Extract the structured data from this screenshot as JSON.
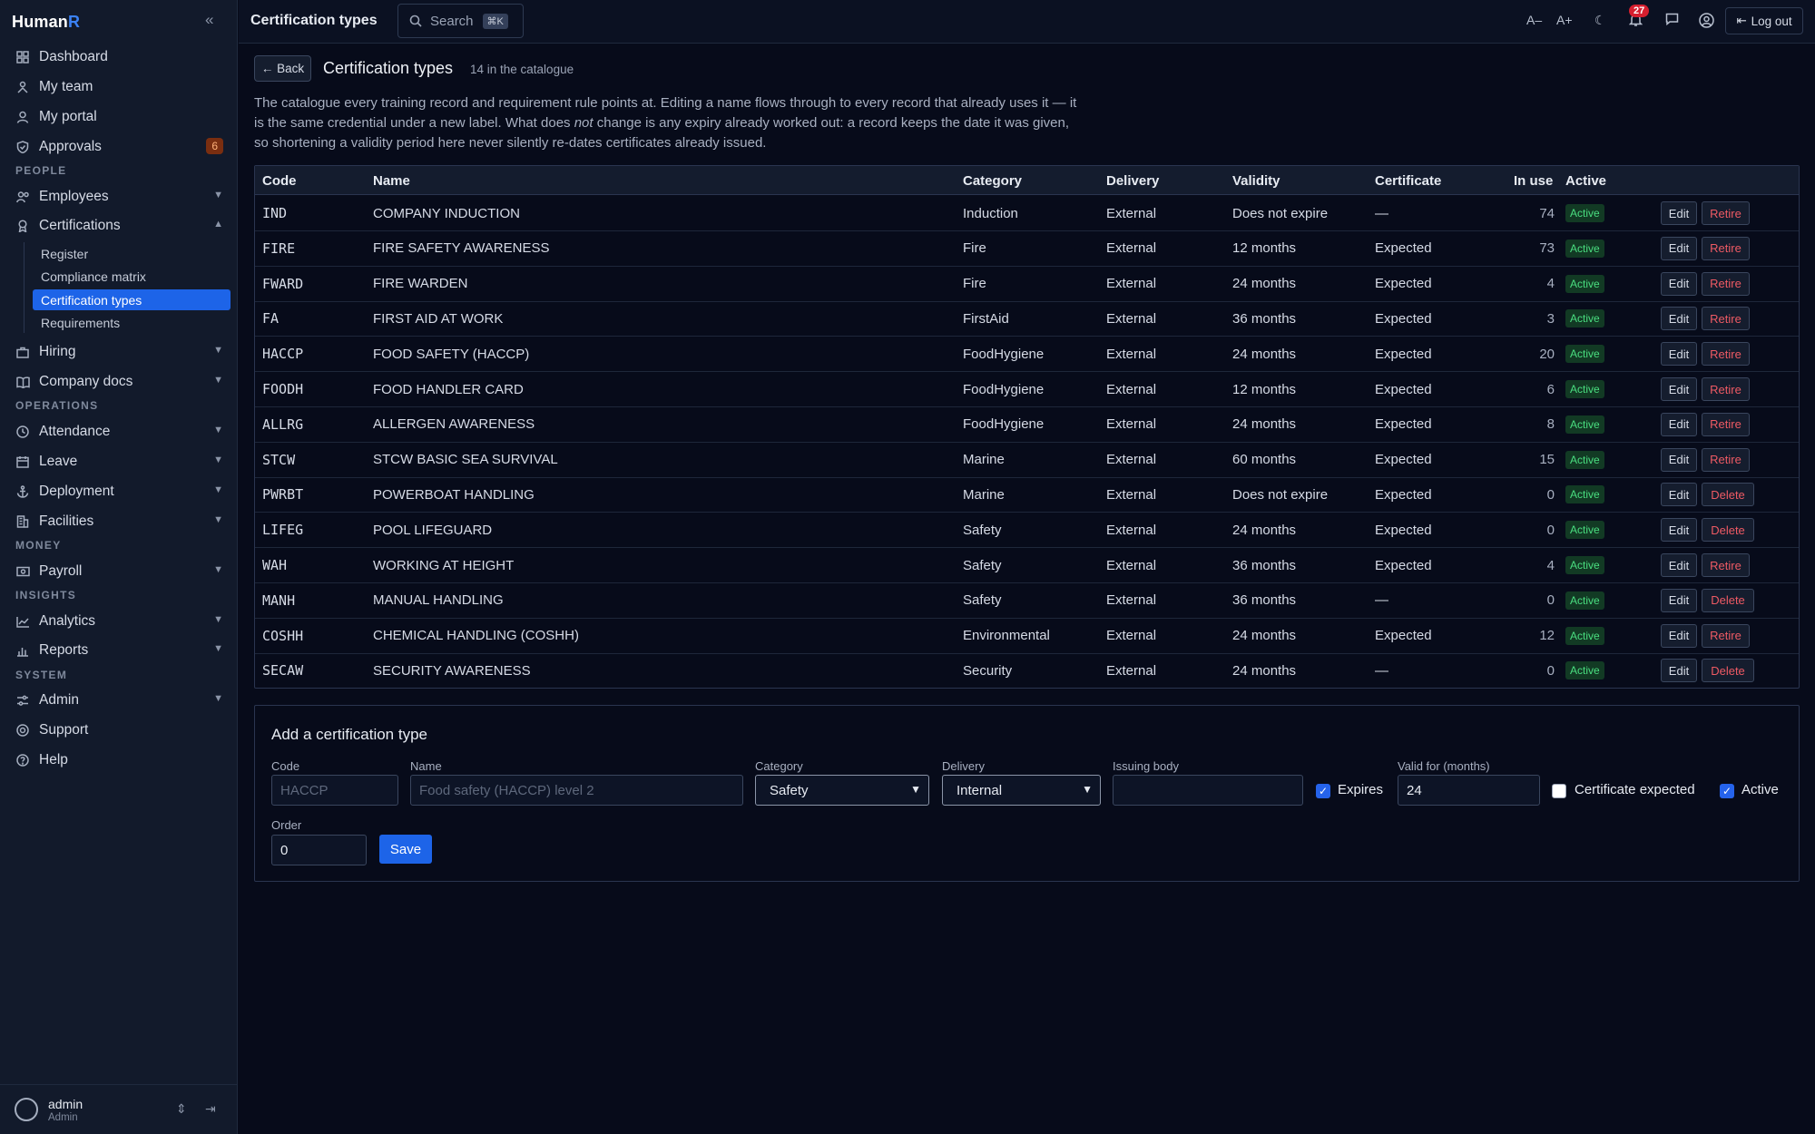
{
  "app": {
    "name_prefix": "Human",
    "name_accent": "R"
  },
  "sidebar": {
    "items": [
      {
        "label": "Dashboard"
      },
      {
        "label": "My team"
      },
      {
        "label": "My portal"
      },
      {
        "label": "Approvals",
        "badge": "6"
      },
      {
        "label": "Employees"
      },
      {
        "label": "Certifications"
      },
      {
        "label": "Hiring"
      },
      {
        "label": "Company docs"
      },
      {
        "label": "Attendance"
      },
      {
        "label": "Leave"
      },
      {
        "label": "Deployment"
      },
      {
        "label": "Facilities"
      },
      {
        "label": "Payroll"
      },
      {
        "label": "Analytics"
      },
      {
        "label": "Reports"
      },
      {
        "label": "Admin"
      },
      {
        "label": "Support"
      },
      {
        "label": "Help"
      }
    ],
    "sections": [
      "PEOPLE",
      "OPERATIONS",
      "MONEY",
      "INSIGHTS",
      "SYSTEM"
    ],
    "sub_items": [
      "Register",
      "Compliance matrix",
      "Certification types",
      "Requirements"
    ],
    "user": {
      "name": "admin",
      "role": "Admin"
    }
  },
  "topbar": {
    "title": "Certification types",
    "search_label": "Search",
    "search_shortcut": "⌘K",
    "font_smaller": "A–",
    "font_larger": "A+",
    "notification_count": "27",
    "logout_label": "Log out"
  },
  "page": {
    "back_label": "← Back",
    "title": "Certification types",
    "count_text": "14 in the catalogue",
    "intro_part1": "The catalogue every training record and requirement rule points at. Editing a name flows through to every record that already uses it — it is the same credential under a new label. What does ",
    "intro_em": "not",
    "intro_part2": " change is any expiry already worked out: a record keeps the date it was given, so shortening a validity period here never silently re-dates certificates already issued."
  },
  "table": {
    "columns": [
      "Code",
      "Name",
      "Category",
      "Delivery",
      "Validity",
      "Certificate",
      "In use",
      "Active"
    ],
    "edit_label": "Edit",
    "rows": [
      {
        "code": "IND",
        "name": "COMPANY INDUCTION",
        "category": "Induction",
        "delivery": "External",
        "validity": "Does not expire",
        "certificate": "—",
        "in_use": "74",
        "active": "Active",
        "action": "Retire"
      },
      {
        "code": "FIRE",
        "name": "FIRE SAFETY AWARENESS",
        "category": "Fire",
        "delivery": "External",
        "validity": "12 months",
        "certificate": "Expected",
        "in_use": "73",
        "active": "Active",
        "action": "Retire"
      },
      {
        "code": "FWARD",
        "name": "FIRE WARDEN",
        "category": "Fire",
        "delivery": "External",
        "validity": "24 months",
        "certificate": "Expected",
        "in_use": "4",
        "active": "Active",
        "action": "Retire"
      },
      {
        "code": "FA",
        "name": "FIRST AID AT WORK",
        "category": "FirstAid",
        "delivery": "External",
        "validity": "36 months",
        "certificate": "Expected",
        "in_use": "3",
        "active": "Active",
        "action": "Retire"
      },
      {
        "code": "HACCP",
        "name": "FOOD SAFETY (HACCP)",
        "category": "FoodHygiene",
        "delivery": "External",
        "validity": "24 months",
        "certificate": "Expected",
        "in_use": "20",
        "active": "Active",
        "action": "Retire"
      },
      {
        "code": "FOODH",
        "name": "FOOD HANDLER CARD",
        "category": "FoodHygiene",
        "delivery": "External",
        "validity": "12 months",
        "certificate": "Expected",
        "in_use": "6",
        "active": "Active",
        "action": "Retire"
      },
      {
        "code": "ALLRG",
        "name": "ALLERGEN AWARENESS",
        "category": "FoodHygiene",
        "delivery": "External",
        "validity": "24 months",
        "certificate": "Expected",
        "in_use": "8",
        "active": "Active",
        "action": "Retire"
      },
      {
        "code": "STCW",
        "name": "STCW BASIC SEA SURVIVAL",
        "category": "Marine",
        "delivery": "External",
        "validity": "60 months",
        "certificate": "Expected",
        "in_use": "15",
        "active": "Active",
        "action": "Retire"
      },
      {
        "code": "PWRBT",
        "name": "POWERBOAT HANDLING",
        "category": "Marine",
        "delivery": "External",
        "validity": "Does not expire",
        "certificate": "Expected",
        "in_use": "0",
        "active": "Active",
        "action": "Delete"
      },
      {
        "code": "LIFEG",
        "name": "POOL LIFEGUARD",
        "category": "Safety",
        "delivery": "External",
        "validity": "24 months",
        "certificate": "Expected",
        "in_use": "0",
        "active": "Active",
        "action": "Delete"
      },
      {
        "code": "WAH",
        "name": "WORKING AT HEIGHT",
        "category": "Safety",
        "delivery": "External",
        "validity": "36 months",
        "certificate": "Expected",
        "in_use": "4",
        "active": "Active",
        "action": "Retire"
      },
      {
        "code": "MANH",
        "name": "MANUAL HANDLING",
        "category": "Safety",
        "delivery": "External",
        "validity": "36 months",
        "certificate": "—",
        "in_use": "0",
        "active": "Active",
        "action": "Delete"
      },
      {
        "code": "COSHH",
        "name": "CHEMICAL HANDLING (COSHH)",
        "category": "Environmental",
        "delivery": "External",
        "validity": "24 months",
        "certificate": "Expected",
        "in_use": "12",
        "active": "Active",
        "action": "Retire"
      },
      {
        "code": "SECAW",
        "name": "SECURITY AWARENESS",
        "category": "Security",
        "delivery": "External",
        "validity": "24 months",
        "certificate": "—",
        "in_use": "0",
        "active": "Active",
        "action": "Delete"
      }
    ]
  },
  "form": {
    "title": "Add a certification type",
    "code_label": "Code",
    "code_placeholder": "HACCP",
    "code_value": "",
    "name_label": "Name",
    "name_placeholder": "Food safety (HACCP) level 2",
    "name_value": "",
    "category_label": "Category",
    "category_value": "Safety",
    "delivery_label": "Delivery",
    "delivery_value": "Internal",
    "issuing_label": "Issuing body",
    "issuing_value": "",
    "expires_label": "Expires",
    "expires_checked": true,
    "valid_label": "Valid for (months)",
    "valid_value": "24",
    "cert_expected_label": "Certificate expected",
    "cert_expected_checked": false,
    "active_label": "Active",
    "active_checked": true,
    "order_label": "Order",
    "order_value": "0",
    "save_label": "Save"
  },
  "colors": {
    "accent": "#1d64e8",
    "active_pill": "#4ade80",
    "danger": "#ef5a64",
    "badge": "#d61f2f"
  }
}
